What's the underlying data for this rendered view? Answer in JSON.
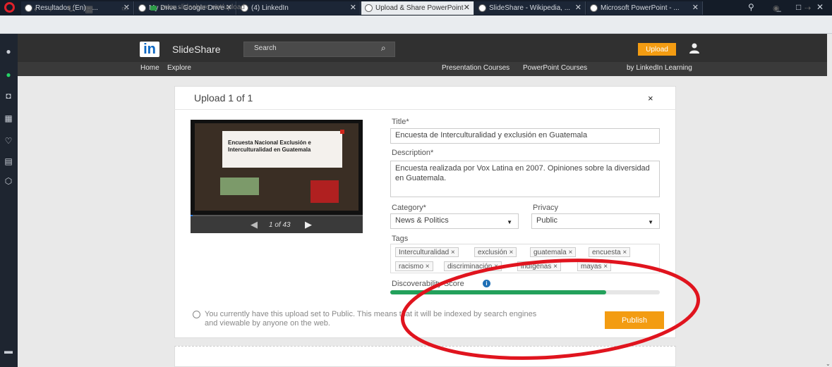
{
  "browser": {
    "tabs": [
      {
        "title": "Resultados (En) - ...",
        "active": false
      },
      {
        "title": "My Drive - Google Drive",
        "active": false
      },
      {
        "title": "(4) LinkedIn",
        "active": false
      },
      {
        "title": "Upload & Share PowerPoint",
        "active": true
      },
      {
        "title": "SlideShare - Wikipedia, ...",
        "active": false
      },
      {
        "title": "Microsoft PowerPoint - ...",
        "active": false
      }
    ],
    "url": "www.slideshare.net/upload",
    "window_controls": {
      "minimize": "_",
      "maximize": "□",
      "close": "✕"
    }
  },
  "header": {
    "logo_text": "in",
    "brand": "SlideShare",
    "search_placeholder": "Search",
    "upload_label": "Upload",
    "nav": {
      "home": "Home",
      "explore": "Explore",
      "presentation_courses": "Presentation Courses",
      "powerpoint_courses": "PowerPoint Courses",
      "linkedin_learning": "by LinkedIn Learning"
    }
  },
  "upload": {
    "title": "Upload 1 of 1",
    "close": "×",
    "preview": {
      "slide_title": "Encuesta Nacional Exclusión e Interculturalidad en Guatemala",
      "pager": "1 of 43"
    },
    "form": {
      "title_label": "Title*",
      "title_value": "Encuesta de Interculturalidad y exclusión en Guatemala",
      "description_label": "Description*",
      "description_value": "Encuesta realizada por Vox Latina en 2007. Opiniones sobre la diversidad en Guatemala.",
      "category_label": "Category*",
      "category_value": "News & Politics",
      "privacy_label": "Privacy",
      "privacy_value": "Public",
      "tags_label": "Tags",
      "tags": [
        "Interculturalidad",
        "exclusión",
        "guatemala",
        "encuesta",
        "racismo",
        "discriminación",
        "indígenas",
        "mayas"
      ],
      "discoverability_label": "Discoverability Score",
      "discoverability_score": 0.8
    },
    "info_message": "You currently have this upload set to Public. This means that it will be indexed by search engines and viewable by anyone on the web.",
    "publish_label": "Publish"
  },
  "colors": {
    "accent": "#f39c12",
    "linkedin": "#0a66c2",
    "score": "#23a15b",
    "annotation": "#e0141e"
  }
}
